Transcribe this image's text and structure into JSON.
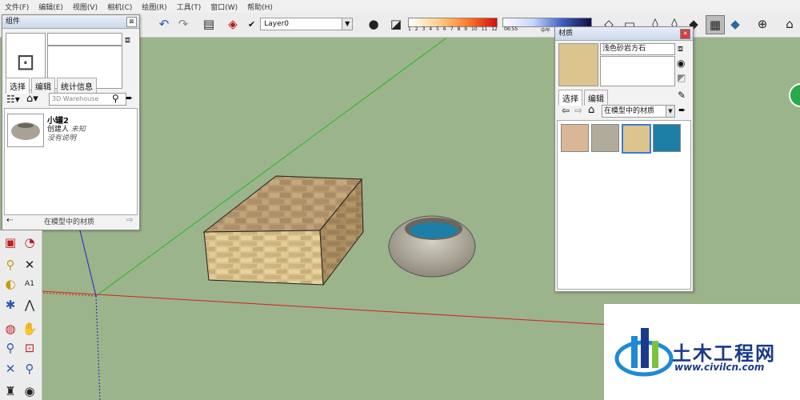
{
  "menu": [
    "文件(F)",
    "编辑(E)",
    "视图(V)",
    "相机(C)",
    "绘图(R)",
    "工具(T)",
    "窗口(W)",
    "帮助(H)"
  ],
  "toolbar": {
    "layer_value": "Layer0",
    "shadow_ticks": [
      "1",
      "2",
      "3",
      "4",
      "5",
      "6",
      "7",
      "8",
      "9",
      "10",
      "11",
      "12"
    ],
    "time_start": "06:55",
    "time_mid": "中午"
  },
  "components_panel": {
    "title": "组件",
    "tabs": [
      "选择",
      "编辑",
      "统计信息"
    ],
    "search_placeholder": "3D Warehouse",
    "item": {
      "name": "小罐2",
      "creator_label": "创建人",
      "creator_value": "未知",
      "description": "没有说明"
    },
    "footer": "在模型中的材质"
  },
  "materials_panel": {
    "title": "材质",
    "material_name": "浅色砂岩方石",
    "tabs": [
      "选择",
      "编辑"
    ],
    "dropdown_value": "在模型中的材质",
    "swatches": [
      {
        "name": "beige",
        "color": "#d9b796"
      },
      {
        "name": "gray-stucco",
        "color": "#b0ab9a"
      },
      {
        "name": "sandstone",
        "color": "#dcc48e"
      },
      {
        "name": "water",
        "color": "#1e7fa6"
      }
    ]
  },
  "watermark": {
    "title": "土木工程网",
    "url": "www.civilcn.com"
  },
  "colors": {
    "ground": "#9cb48b",
    "axis_red": "#cc2222",
    "axis_green": "#22bb22",
    "axis_blue": "#2222cc"
  }
}
